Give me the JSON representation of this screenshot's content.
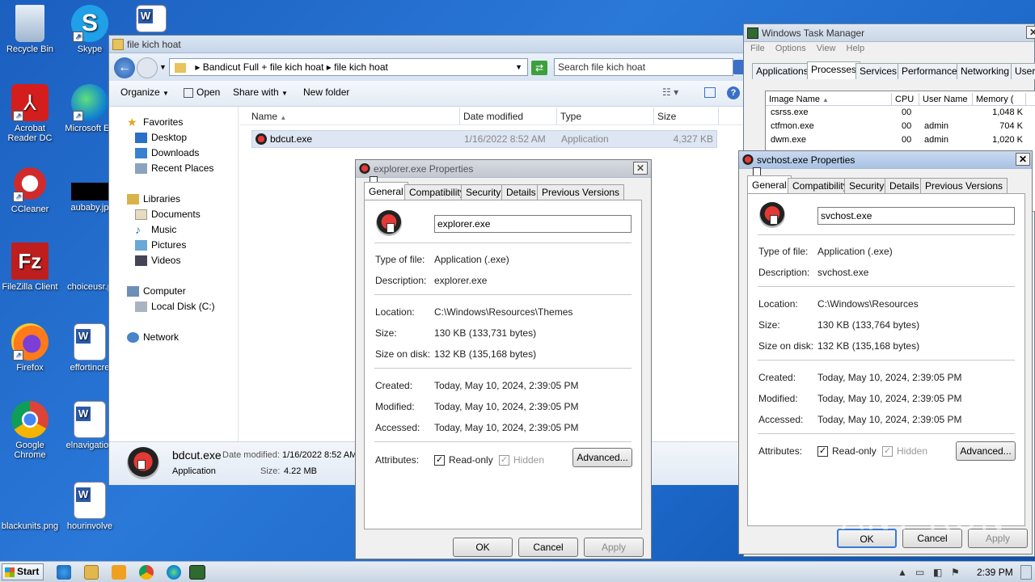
{
  "desktop": {
    "icons": [
      {
        "label": "Recycle Bin",
        "icon": "recycle-bin-icon"
      },
      {
        "label": "Skype",
        "icon": "skype-icon"
      },
      {
        "label": "Acrobat Reader DC",
        "icon": "acrobat-icon"
      },
      {
        "label": "Microsoft Ed",
        "icon": "edge-icon"
      },
      {
        "label": "CCleaner",
        "icon": "ccleaner-icon"
      },
      {
        "label": "aubaby.jp",
        "icon": "image-file-icon"
      },
      {
        "label": "FileZilla Client",
        "icon": "filezilla-icon"
      },
      {
        "label": "choiceusr.p",
        "icon": "file-icon"
      },
      {
        "label": "Firefox",
        "icon": "firefox-icon"
      },
      {
        "label": "effortincre",
        "icon": "word-doc-icon"
      },
      {
        "label": "Google Chrome",
        "icon": "chrome-icon"
      },
      {
        "label": "elnavigation",
        "icon": "word-doc-icon"
      },
      {
        "label": "blackunits.png",
        "icon": "image-file-icon"
      },
      {
        "label": "hourinvolve",
        "icon": "word-doc-icon"
      }
    ]
  },
  "explorer": {
    "title": "file kich hoat",
    "breadcrumb": [
      "Bandicut Full + file kich hoat",
      "file kich hoat"
    ],
    "search_placeholder": "Search file kich hoat",
    "toolbar": {
      "organize": "Organize",
      "open": "Open",
      "share_with": "Share with",
      "new_folder": "New folder"
    },
    "nav": {
      "favorites": "Favorites",
      "desktop": "Desktop",
      "downloads": "Downloads",
      "recent": "Recent Places",
      "libraries": "Libraries",
      "documents": "Documents",
      "music": "Music",
      "pictures": "Pictures",
      "videos": "Videos",
      "computer": "Computer",
      "local_disk": "Local Disk (C:)",
      "network": "Network"
    },
    "columns": {
      "name": "Name",
      "date": "Date modified",
      "type": "Type",
      "size": "Size"
    },
    "files": [
      {
        "name": "bdcut.exe",
        "date": "1/16/2022 8:52 AM",
        "type": "Application",
        "size": "4,327 KB"
      }
    ],
    "details": {
      "name": "bdcut.exe",
      "date_label": "Date modified:",
      "date": "1/16/2022 8:52 AM",
      "type": "Application",
      "size_label": "Size:",
      "size": "4.22 MB"
    }
  },
  "explorer_props": {
    "title": "explorer.exe Properties",
    "tabs": [
      "General",
      "Compatibility",
      "Security",
      "Details",
      "Previous Versions"
    ],
    "filename": "explorer.exe",
    "labels": {
      "type": "Type of file:",
      "desc": "Description:",
      "location": "Location:",
      "size": "Size:",
      "size_disk": "Size on disk:",
      "created": "Created:",
      "modified": "Modified:",
      "accessed": "Accessed:",
      "attributes": "Attributes:"
    },
    "type": "Application (.exe)",
    "desc": "explorer.exe",
    "location": "C:\\Windows\\Resources\\Themes",
    "size": "130 KB (133,731 bytes)",
    "size_disk": "132 KB (135,168 bytes)",
    "created": "Today, May 10, 2024, 2:39:05 PM",
    "modified": "Today, May 10, 2024, 2:39:05 PM",
    "accessed": "Today, May 10, 2024, 2:39:05 PM",
    "readonly": "Read-only",
    "hidden": "Hidden",
    "advanced": "Advanced...",
    "ok": "OK",
    "cancel": "Cancel",
    "apply": "Apply"
  },
  "svchost_props": {
    "title": "svchost.exe Properties",
    "tabs": [
      "General",
      "Compatibility",
      "Security",
      "Details",
      "Previous Versions"
    ],
    "filename": "svchost.exe",
    "labels": {
      "type": "Type of file:",
      "desc": "Description:",
      "location": "Location:",
      "size": "Size:",
      "size_disk": "Size on disk:",
      "created": "Created:",
      "modified": "Modified:",
      "accessed": "Accessed:",
      "attributes": "Attributes:"
    },
    "type": "Application (.exe)",
    "desc": "svchost.exe",
    "location": "C:\\Windows\\Resources",
    "size": "130 KB (133,764 bytes)",
    "size_disk": "132 KB (135,168 bytes)",
    "created": "Today, May 10, 2024, 2:39:05 PM",
    "modified": "Today, May 10, 2024, 2:39:05 PM",
    "accessed": "Today, May 10, 2024, 2:39:05 PM",
    "readonly": "Read-only",
    "hidden": "Hidden",
    "advanced": "Advanced...",
    "ok": "OK",
    "cancel": "Cancel",
    "apply": "Apply"
  },
  "task_manager": {
    "title": "Windows Task Manager",
    "menu": [
      "File",
      "Options",
      "View",
      "Help"
    ],
    "tabs": [
      "Applications",
      "Processes",
      "Services",
      "Performance",
      "Networking",
      "Users"
    ],
    "columns": {
      "image": "Image Name",
      "cpu": "CPU",
      "user": "User Name",
      "memory": "Memory ("
    },
    "rows": [
      {
        "image": "csrss.exe",
        "cpu": "00",
        "user": "",
        "memory": "1,048 K"
      },
      {
        "image": "ctfmon.exe",
        "cpu": "00",
        "user": "admin",
        "memory": "704 K"
      },
      {
        "image": "dwm.exe",
        "cpu": "00",
        "user": "admin",
        "memory": "1,020 K"
      }
    ]
  },
  "taskbar": {
    "start": "Start",
    "clock": "2:39 PM"
  },
  "watermark": "ANY RUN"
}
